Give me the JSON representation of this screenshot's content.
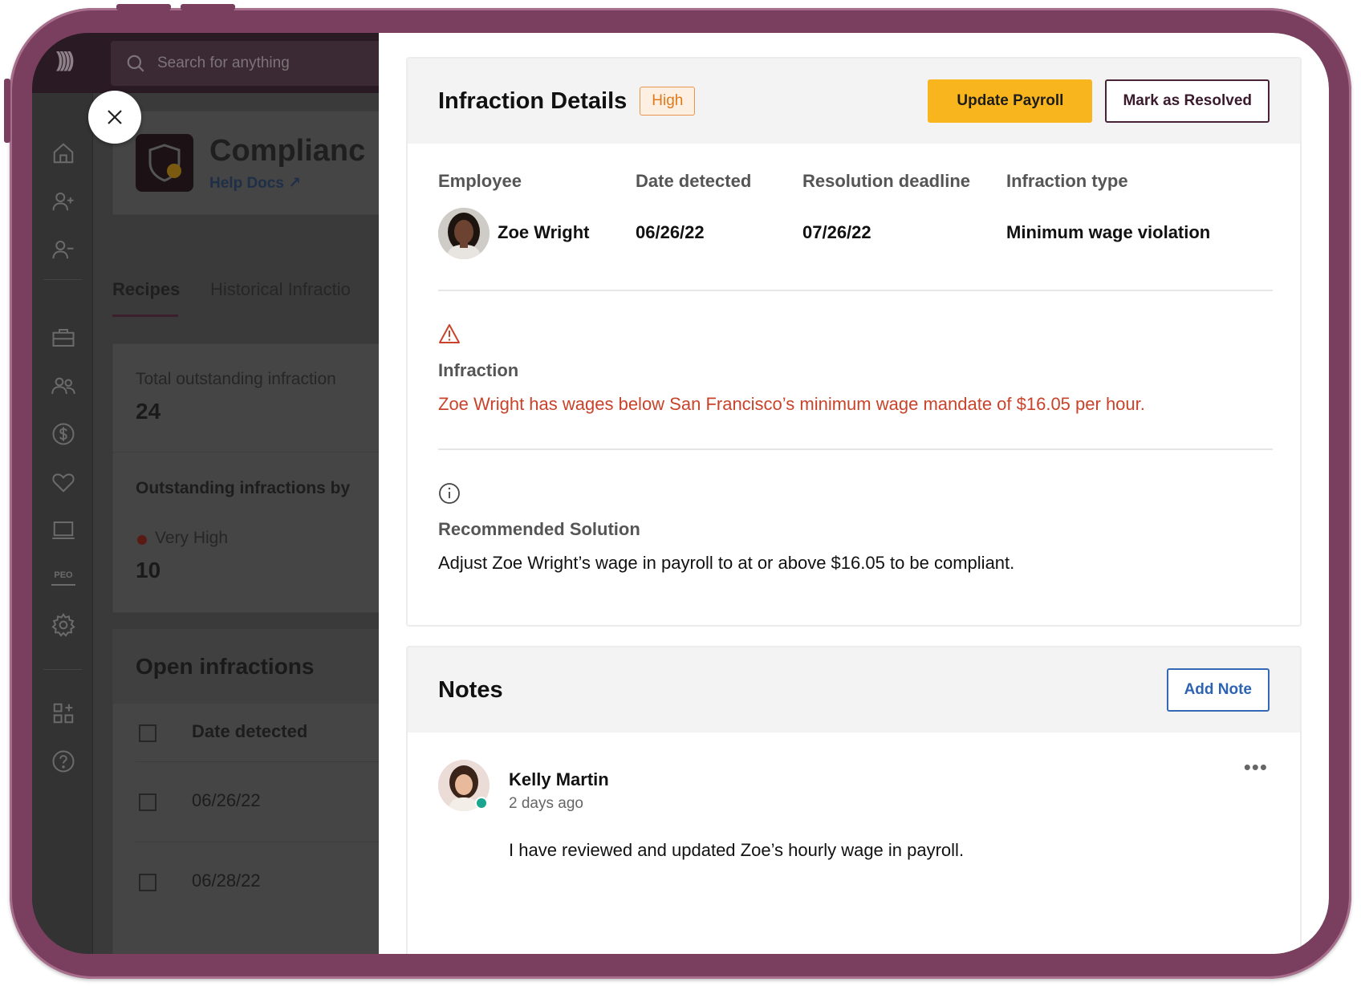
{
  "background_app": {
    "search": {
      "placeholder": "Search for anything"
    },
    "page_title": "Complianc",
    "help_docs_label": "Help Docs",
    "tabs": [
      {
        "label": "Recipes",
        "active": true
      },
      {
        "label": "Historical Infractio",
        "active": false
      }
    ],
    "total_label": "Total outstanding infraction",
    "total_value": "24",
    "by_label": "Outstanding infractions by",
    "very_high_label": "Very High",
    "very_high_value": "10",
    "open_title": "Open infractions",
    "table_header": "Date detected",
    "table_rows": [
      "06/26/22",
      "06/28/22"
    ],
    "sidebar_icons": [
      "home-icon",
      "user-plus-icon",
      "user-minus-icon",
      "briefcase-icon",
      "users-icon",
      "dollar-icon",
      "heart-icon",
      "laptop-icon",
      "peo-icon",
      "settings-icon",
      "apps-add-icon",
      "help-icon"
    ],
    "peo_label": "PEO"
  },
  "infraction": {
    "title": "Infraction Details",
    "severity": "High",
    "update_payroll_label": "Update Payroll",
    "mark_resolved_label": "Mark as Resolved",
    "columns": {
      "employee": "Employee",
      "date_detected": "Date detected",
      "resolution_deadline": "Resolution deadline",
      "infraction_type": "Infraction type"
    },
    "values": {
      "employee": "Zoe Wright",
      "date_detected": "06/26/22",
      "resolution_deadline": "07/26/22",
      "infraction_type": "Minimum wage violation"
    },
    "infraction_label": "Infraction",
    "infraction_text": "Zoe Wright has wages below San Francisco’s minimum wage mandate of $16.05 per hour.",
    "solution_label": "Recommended Solution",
    "solution_text": "Adjust Zoe Wright’s wage in payroll to at or above $16.05 to be compliant."
  },
  "notes": {
    "title": "Notes",
    "add_note_label": "Add Note",
    "items": [
      {
        "author": "Kelly Martin",
        "time": "2 days ago",
        "text": "I have reviewed and updated Zoe’s hourly wage in payroll."
      }
    ],
    "more_label": "•••"
  },
  "colors": {
    "accent_yellow": "#f9b51e",
    "severity_orange": "#e0791a",
    "alert_red": "#c9432b",
    "link_blue": "#2d63b3",
    "frame_plum": "#7a3f5f"
  }
}
